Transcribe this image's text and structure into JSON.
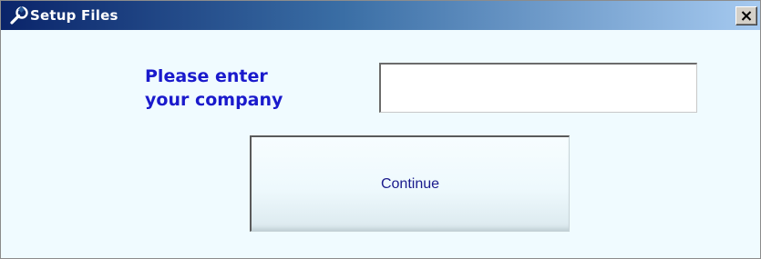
{
  "window": {
    "title": "Setup Files",
    "title_icon": "wrench-icon",
    "close_icon": "close-icon"
  },
  "form": {
    "prompt_line1": "Please enter",
    "prompt_line2": "your company",
    "company_value": "",
    "continue_label": "Continue"
  },
  "colors": {
    "titlebar_start": "#0a246a",
    "titlebar_end": "#a6caf0",
    "background": "#f0fbff",
    "prompt_text": "#1a1acc",
    "button_text": "#1a1a8c"
  }
}
